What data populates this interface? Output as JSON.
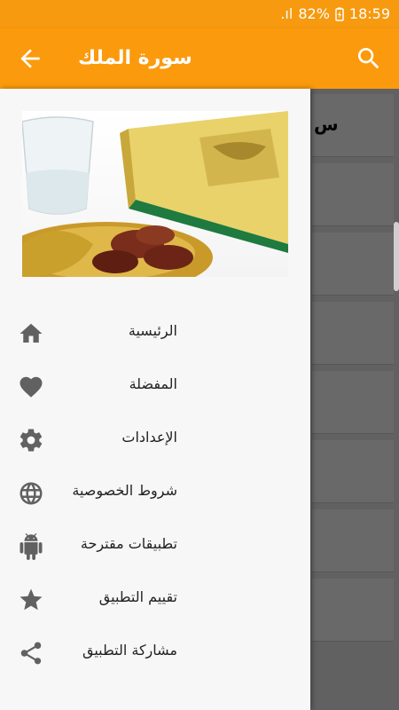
{
  "status_bar": {
    "signal": ".ıl",
    "battery": "82%",
    "time": "18:59"
  },
  "app_bar": {
    "title": "سورة الملك"
  },
  "drawer": {
    "items": [
      {
        "label": "الرئيسية",
        "icon": "home-icon"
      },
      {
        "label": "المفضلة",
        "icon": "heart-icon"
      },
      {
        "label": "الإعدادات",
        "icon": "gear-icon"
      },
      {
        "label": "شروط الخصوصية",
        "icon": "globe-icon"
      },
      {
        "label": "تطبيقات مقترحة",
        "icon": "android-icon"
      },
      {
        "label": "تقييم التطبيق",
        "icon": "star-icon"
      },
      {
        "label": "مشاركة التطبيق",
        "icon": "share-icon"
      }
    ]
  },
  "background_list": {
    "first_char": "س"
  },
  "colors": {
    "accent": "#fb9a0c",
    "icon_gray": "#616161"
  }
}
